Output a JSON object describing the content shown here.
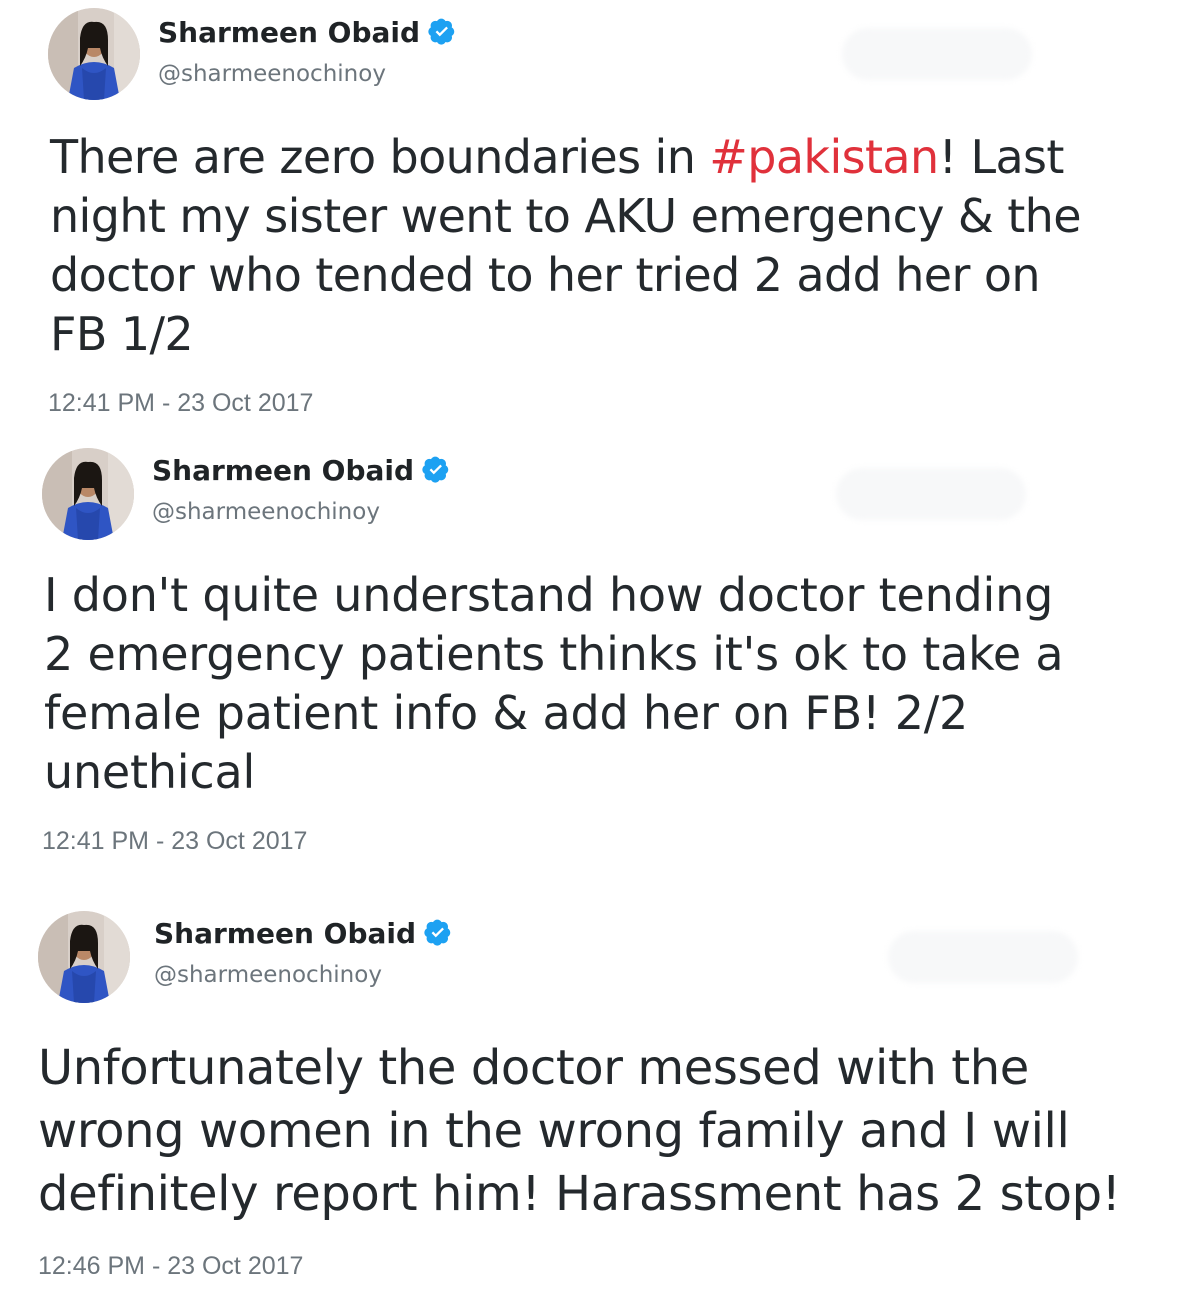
{
  "colors": {
    "hashtag": "#e0313b",
    "verified_badge": "#1da1f2",
    "meta_text": "#6c757c",
    "body_text": "#24292d"
  },
  "icons": {
    "verified": "verified-badge-icon",
    "avatar": "profile-photo"
  },
  "tweets": [
    {
      "display_name": "Sharmeen Obaid",
      "handle": "@sharmeenochinoy",
      "text_lines": [
        {
          "before": "There are zero boundaries in ",
          "hashtag": "#pakistan",
          "after": "! Last"
        },
        "night my sister went to AKU emergency & the",
        "doctor who tended to her tried 2 add her on",
        "FB 1/2"
      ],
      "timestamp": "12:41 PM - 23 Oct 2017"
    },
    {
      "display_name": "Sharmeen Obaid",
      "handle": "@sharmeenochinoy",
      "text_lines": [
        "I don't quite understand how doctor tending",
        "2 emergency patients thinks it's ok to take a",
        "female patient info & add her on FB! 2/2",
        "unethical"
      ],
      "timestamp": "12:41 PM - 23 Oct 2017"
    },
    {
      "display_name": "Sharmeen Obaid",
      "handle": "@sharmeenochinoy",
      "text_lines": [
        "Unfortunately the doctor messed with the",
        "wrong women in the wrong family and I will",
        "definitely report him!  Harassment has 2 stop!"
      ],
      "timestamp": "12:46 PM - 23 Oct 2017"
    }
  ]
}
